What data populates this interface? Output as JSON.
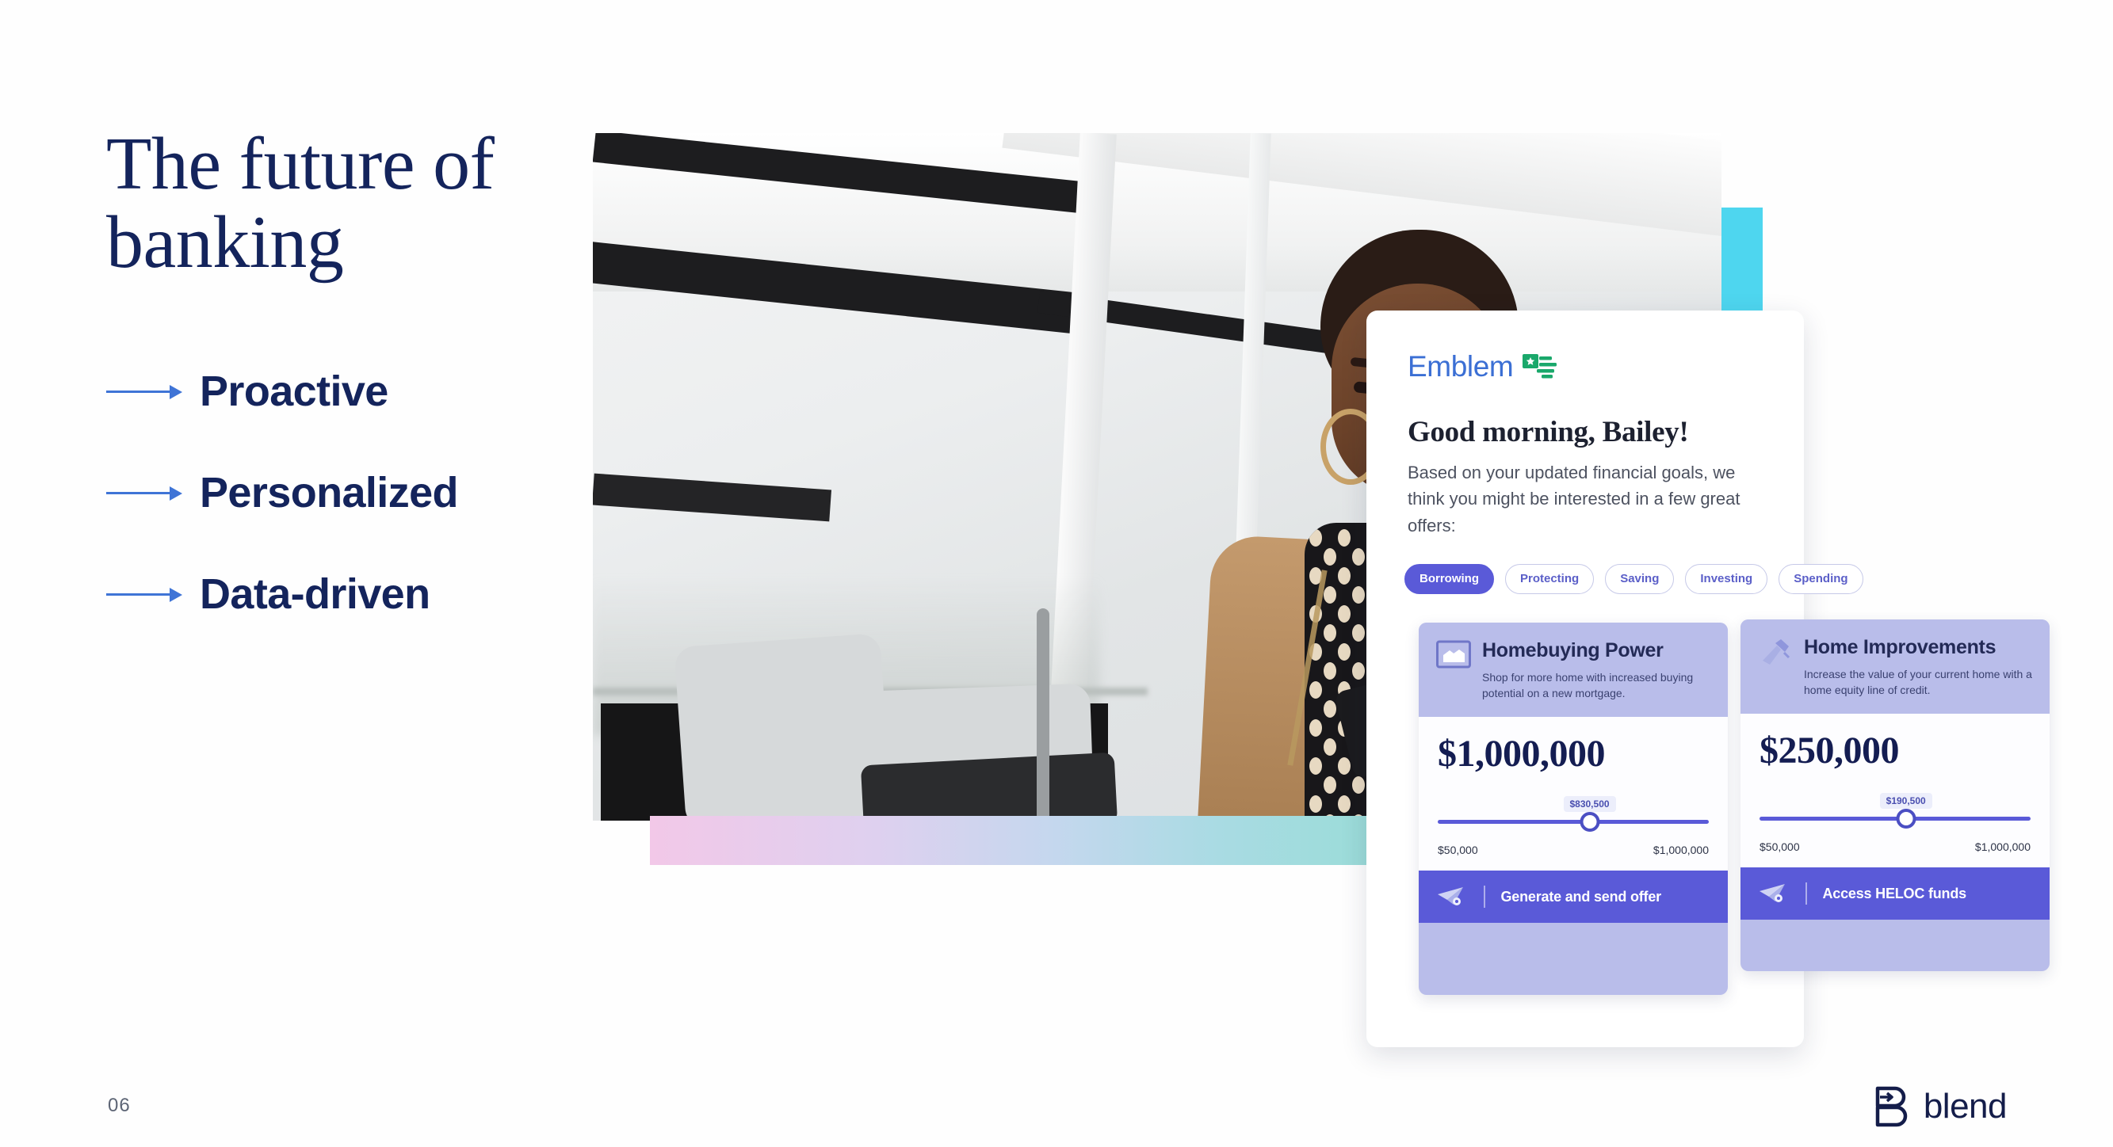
{
  "slide": {
    "title": "The future of\nbanking",
    "page_number": "06",
    "bullets": [
      {
        "label": "Proactive",
        "icon": "arrow-right-icon"
      },
      {
        "label": "Personalized",
        "icon": "arrow-right-icon"
      },
      {
        "label": "Data-driven",
        "icon": "arrow-right-icon"
      }
    ],
    "accent_teal": "#4ed6ef",
    "accent_indigo": "#5a5ad8",
    "title_color": "#14245c"
  },
  "brand": {
    "name": "blend",
    "mark_icon": "blend-b-mark-icon",
    "color": "#141d4a"
  },
  "photo": {
    "alt_name": "woman-on-transit-using-phone-photo",
    "gradient_bar_colors": [
      "#f2c8e8",
      "#c5d7ee",
      "#9adcd8"
    ]
  },
  "app": {
    "logo_text": "Emblem",
    "logo_icon": "emblem-flag-icon",
    "logo_color": "#3b6fd4",
    "logo_mark_color": "#1aa86b",
    "greeting": "Good morning, Bailey!",
    "greeting_sub": "Based on your updated financial goals, we think you might be interested in a few great offers:",
    "chips": [
      {
        "label": "Borrowing",
        "active": true
      },
      {
        "label": "Protecting",
        "active": false
      },
      {
        "label": "Saving",
        "active": false
      },
      {
        "label": "Investing",
        "active": false
      },
      {
        "label": "Spending",
        "active": false
      }
    ],
    "offers": [
      {
        "title": "Homebuying Power",
        "description": "Shop for more home with increased buying potential on a new mortgage.",
        "icon": "house-frame-icon",
        "amount": "$1,000,000",
        "slider": {
          "tooltip_value": "$830,500",
          "min_label": "$50,000",
          "max_label": "$1,000,000",
          "knob_position_pct": 56
        },
        "cta_label": "Generate and send offer",
        "cta_icon": "paper-plane-icon"
      },
      {
        "title": "Home Improvements",
        "description": "Increase the value of your current home with a home equity line of credit.",
        "icon": "hammer-icon",
        "amount": "$250,000",
        "slider": {
          "tooltip_value": "$190,500",
          "min_label": "$50,000",
          "max_label": "$1,000,000",
          "knob_position_pct": 54
        },
        "cta_label": "Access HELOC funds",
        "cta_icon": "paper-plane-icon"
      }
    ]
  }
}
